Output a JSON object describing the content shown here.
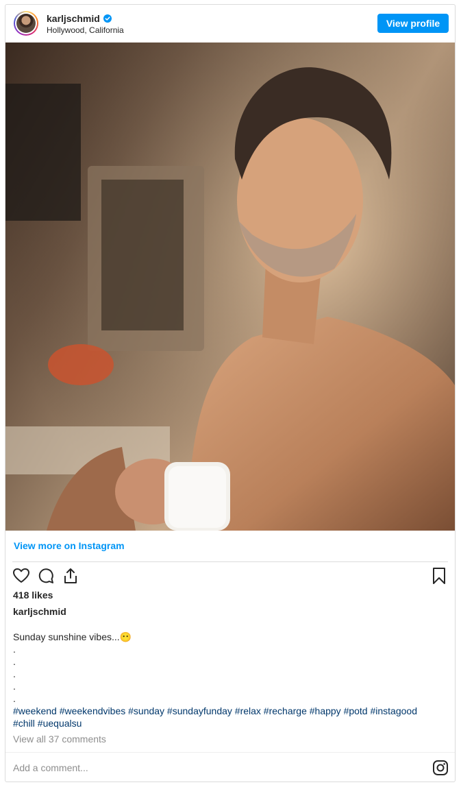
{
  "header": {
    "username": "karljschmid",
    "location": "Hollywood, California",
    "view_profile_label": "View profile"
  },
  "photo": {
    "description_icon": "photo"
  },
  "view_more_label": "View more on Instagram",
  "actions": {
    "icons": [
      "heart-icon",
      "comment-icon",
      "share-icon",
      "bookmark-icon"
    ]
  },
  "likes_text": "418 likes",
  "caption": {
    "username": "karljschmid",
    "text": "Sunday sunshine vibes...",
    "emoji": "😶",
    "dots": [
      ".",
      ".",
      ".",
      ".",
      "."
    ],
    "hashtags_line1": "#weekend #weekendvibes #sunday #sundayfunday #relax #recharge #happy #potd #instagood",
    "hashtags_line2": "#chill #uequalsu"
  },
  "comments_link": "View all 37 comments",
  "add_comment_placeholder": "Add a comment...",
  "colors": {
    "accent": "#0095f6",
    "hashtag": "#00376b",
    "muted": "#8e8e8e"
  }
}
